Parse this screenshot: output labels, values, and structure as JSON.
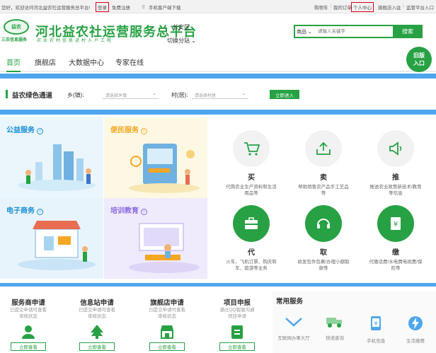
{
  "topbar": {
    "welcome": "您好，欢迎访问河北益农社运营服务总平台!",
    "login": "登录",
    "register": "免费注册",
    "mobile": "手机客户端下载",
    "cart": "购物车",
    "orders": "我的订单",
    "center": "个人中心",
    "flagship": "旗舰店入驻",
    "admin": "监管平台入口"
  },
  "header": {
    "logo_mark": "益农",
    "logo_sub": "三农信息服务",
    "title": "河北益农社运营服务总平台",
    "slogan": "农业农村信息进村入户工程",
    "region": "长安区",
    "switch": "切换分站",
    "search_category": "商品",
    "search_placeholder": "请输入关键字",
    "search_button": "搜索",
    "old_version": "旧版入口"
  },
  "nav": {
    "items": [
      "首页",
      "旗舰店",
      "大数据中心",
      "专家在线"
    ]
  },
  "channel": {
    "title": "益农绿色通道",
    "town_label": "乡(镇):",
    "town_placeholder": "请选择乡镇",
    "village_label": "村(居):",
    "village_placeholder": "请选择村居",
    "enter": "立即进入"
  },
  "tiles": [
    {
      "title": "公益服务",
      "color": "#1a8fd8",
      "bg": "#eaf6fc"
    },
    {
      "title": "便民服务",
      "color": "#f5a623",
      "bg": "#fdf8e3"
    },
    {
      "title": "电子商务",
      "color": "#1a8fd8",
      "bg": "#e8f4fc"
    },
    {
      "title": "培训教育",
      "color": "#8c6be0",
      "bg": "#efeafc"
    }
  ],
  "services": [
    {
      "name": "买",
      "desc": "代购农业生产资料和生活用品等",
      "icon": "cart-icon"
    },
    {
      "name": "卖",
      "desc": "帮助销售农产品手工艺品等",
      "icon": "upload-icon"
    },
    {
      "name": "推",
      "desc": "推送农业政策新技术/教育等信息",
      "icon": "speaker-icon"
    },
    {
      "name": "代",
      "desc": "火车、飞机订票、购庆和车、旅游等业务",
      "icon": "briefcase-icon"
    },
    {
      "name": "取",
      "desc": "收发包件包裹/办理小额取款等",
      "icon": "headset-icon"
    },
    {
      "name": "缴",
      "desc": "代缴话费/水电费电视费/保险等",
      "icon": "bill-icon"
    }
  ],
  "applications": [
    {
      "title": "服务商申请",
      "line1": "已提交申请可查看",
      "line2": "审核状态",
      "button": "立即查看",
      "icon": "user-icon"
    },
    {
      "title": "信息站申请",
      "line1": "已提交申请可查看",
      "line2": "审核状态",
      "button": "立即查看",
      "icon": "tree-icon"
    },
    {
      "title": "旗舰店申请",
      "line1": "已提交申请可查看",
      "line2": "审核状态",
      "button": "立即查看",
      "icon": "store-icon"
    },
    {
      "title": "项目申报",
      "line1": "通过QQ客服沟通",
      "line2": "项目申请",
      "button": "立即查看",
      "icon": "document-icon"
    }
  ],
  "common": {
    "title": "常用服务",
    "items": [
      {
        "label": "互联网办事大厅",
        "icon": "chevron-down-icon"
      },
      {
        "label": "快递查询",
        "icon": "delivery-icon"
      },
      {
        "label": "手机充值",
        "icon": "phone-icon"
      },
      {
        "label": "生活缴费",
        "icon": "bolt-icon"
      }
    ]
  },
  "colors": {
    "brand": "#27a144",
    "blue": "#4ea6ef",
    "alert": "#d9001b"
  }
}
